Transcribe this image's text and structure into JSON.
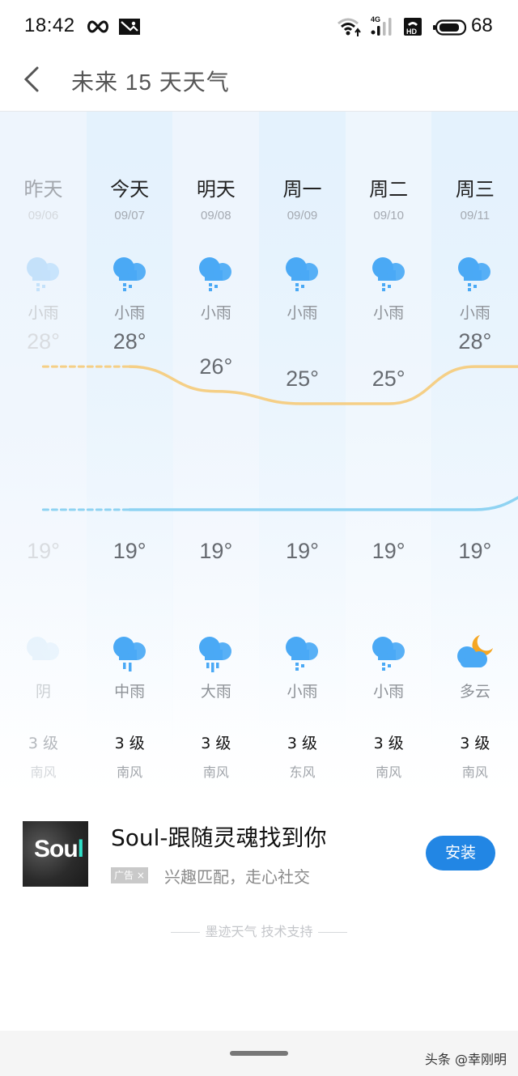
{
  "status_bar": {
    "time": "18:42",
    "icons": [
      "infinity-icon",
      "gallery-icon",
      "wifi-icon",
      "signal-4g-icon",
      "hd-call-icon",
      "battery-icon"
    ],
    "network_label": "4G",
    "battery_level": "68"
  },
  "header": {
    "back_icon": "chevron-left-icon",
    "title": "未来 15 天天气"
  },
  "forecast": {
    "colors": {
      "high_line": "#f5cf86",
      "low_line": "#8fd3f2",
      "rain_icon": "#4aa9f5",
      "moon": "#f5a623"
    },
    "days": [
      {
        "day": "昨天",
        "date": "09/06",
        "day_icon": "light-rain-icon",
        "day_desc": "小雨",
        "high": "28°",
        "low": "19°",
        "night_icon": "overcast-icon",
        "night_desc": "阴",
        "wind_level": "3 级",
        "wind_dir": "南风",
        "past": true
      },
      {
        "day": "今天",
        "date": "09/07",
        "day_icon": "light-rain-icon",
        "day_desc": "小雨",
        "high": "28°",
        "low": "19°",
        "night_icon": "moderate-rain-icon",
        "night_desc": "中雨",
        "wind_level": "3 级",
        "wind_dir": "南风",
        "past": false
      },
      {
        "day": "明天",
        "date": "09/08",
        "day_icon": "light-rain-icon",
        "day_desc": "小雨",
        "high": "26°",
        "low": "19°",
        "night_icon": "heavy-rain-icon",
        "night_desc": "大雨",
        "wind_level": "3 级",
        "wind_dir": "南风",
        "past": false
      },
      {
        "day": "周一",
        "date": "09/09",
        "day_icon": "light-rain-icon",
        "day_desc": "小雨",
        "high": "25°",
        "low": "19°",
        "night_icon": "light-rain-icon",
        "night_desc": "小雨",
        "wind_level": "3 级",
        "wind_dir": "东风",
        "past": false
      },
      {
        "day": "周二",
        "date": "09/10",
        "day_icon": "light-rain-icon",
        "day_desc": "小雨",
        "high": "25°",
        "low": "19°",
        "night_icon": "light-rain-icon",
        "night_desc": "小雨",
        "wind_level": "3 级",
        "wind_dir": "南风",
        "past": false
      },
      {
        "day": "周三",
        "date": "09/11",
        "day_icon": "light-rain-icon",
        "day_desc": "小雨",
        "high": "28°",
        "low": "19°",
        "night_icon": "partly-cloudy-night-icon",
        "night_desc": "多云",
        "wind_level": "3 级",
        "wind_dir": "南风",
        "past": false
      }
    ],
    "high_values": [
      28,
      28,
      26,
      25,
      25,
      28,
      28
    ],
    "low_values": [
      19,
      19,
      19,
      19,
      19,
      19,
      20
    ]
  },
  "ad": {
    "logo_text": "Sou",
    "logo_accent": "l",
    "title": "Soul-跟随灵魂找到你",
    "badge": "广告 ×",
    "description": "兴趣匹配，走心社交",
    "install_label": "安装"
  },
  "footer": {
    "powered_by": "墨迹天气 技术支持"
  },
  "nav": {
    "watermark": "头条 @幸刚明"
  }
}
